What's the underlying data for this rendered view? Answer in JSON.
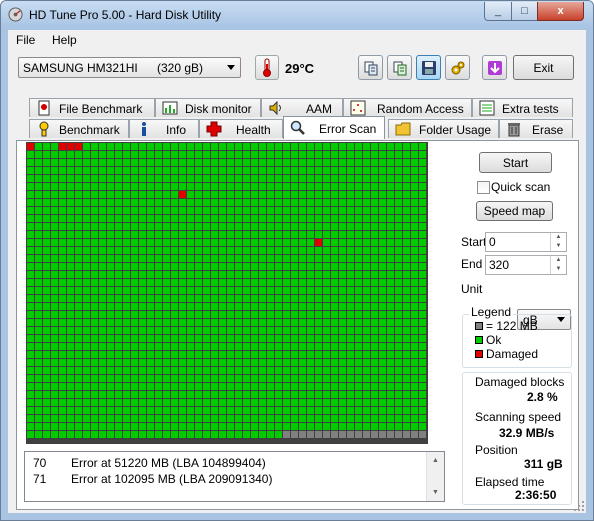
{
  "window": {
    "title": "HD Tune Pro 5.00 - Hard Disk Utility",
    "close_label": "x",
    "min_label": "_",
    "max_label": "□"
  },
  "menu": {
    "file": "File",
    "help": "Help"
  },
  "toolbar": {
    "drive_name": "SAMSUNG HM321HI",
    "drive_capacity": "(320 gB)",
    "temperature": "29°C",
    "icons": [
      "copy-icon",
      "copy-all-icon",
      "save-icon",
      "settings-icon",
      "download-icon"
    ],
    "exit_label": "Exit"
  },
  "tabs": {
    "top_row": [
      {
        "label": "File Benchmark",
        "icon": "file-benchmark-icon"
      },
      {
        "label": "Disk monitor",
        "icon": "disk-monitor-icon"
      },
      {
        "label": "AAM",
        "icon": "speaker-icon"
      },
      {
        "label": "Random Access",
        "icon": "random-access-icon"
      },
      {
        "label": "Extra tests",
        "icon": "extra-tests-icon"
      }
    ],
    "bottom_row": [
      {
        "label": "Benchmark",
        "icon": "benchmark-icon"
      },
      {
        "label": "Info",
        "icon": "info-icon"
      },
      {
        "label": "Health",
        "icon": "health-cross-icon"
      },
      {
        "label": "Error Scan",
        "icon": "magnifier-icon",
        "active": true
      },
      {
        "label": "Folder Usage",
        "icon": "folder-icon"
      },
      {
        "label": "Erase",
        "icon": "trash-icon"
      }
    ]
  },
  "scan_grid": {
    "columns": 50,
    "rows": 37,
    "ok_color": "#00cc00",
    "damaged_color": "#e00000",
    "pending_color": "#808080",
    "grid_line_color": "#404040",
    "damaged_blocks": [
      [
        0,
        0
      ],
      [
        0,
        4
      ],
      [
        0,
        5
      ],
      [
        0,
        6
      ],
      [
        6,
        19
      ],
      [
        12,
        36
      ]
    ],
    "pending_from_row": 36,
    "pending_from_col": 32
  },
  "error_log": [
    {
      "no": "70",
      "message": "Error at 51220 MB (LBA 104899404)"
    },
    {
      "no": "71",
      "message": "Error at 102095 MB (LBA 209091340)"
    }
  ],
  "controls": {
    "start_button": "Start",
    "quick_scan_label": "Quick scan",
    "quick_scan_checked": false,
    "speed_map_button": "Speed map",
    "start_label": "Start",
    "start_value": "0",
    "end_label": "End",
    "end_value": "320",
    "unit_label": "Unit",
    "unit_value": "gB"
  },
  "legend": {
    "title": "Legend",
    "block_size": "= 122 MB",
    "ok": "Ok",
    "damaged": "Damaged"
  },
  "stats": {
    "damaged_blocks_label": "Damaged blocks",
    "damaged_blocks_value": "2.8 %",
    "scanning_speed_label": "Scanning speed",
    "scanning_speed_value": "32.9 MB/s",
    "position_label": "Position",
    "position_value": "311 gB",
    "elapsed_label": "Elapsed time",
    "elapsed_value": "2:36:50"
  }
}
